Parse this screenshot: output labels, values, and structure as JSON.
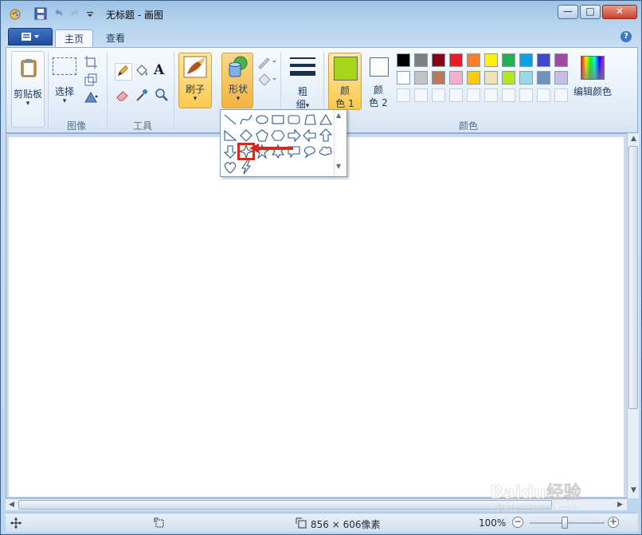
{
  "window": {
    "title": "无标题 - 画图",
    "controls": {
      "minimize": "—",
      "maximize": "□",
      "close": "✕"
    }
  },
  "tabs": {
    "home": "主页",
    "view": "查看",
    "help": "?"
  },
  "ribbon": {
    "clipboard": {
      "label": "剪贴板"
    },
    "image": {
      "select_label": "选择",
      "group_label": "图像"
    },
    "tools": {
      "group_label": "工具",
      "text_tool": "A"
    },
    "brushes": {
      "label": "刷子"
    },
    "shapes": {
      "label": "形状"
    },
    "size": {
      "label_line1": "粗",
      "label_line2": "细"
    },
    "color1": {
      "label_line1": "颜",
      "label_line2": "色 1",
      "color": "#a6d51c"
    },
    "color2": {
      "label_line1": "颜",
      "label_line2": "色 2",
      "color": "#ffffff"
    },
    "colors_group_label": "颜色",
    "edit_colors_label": "编辑颜色",
    "palette_row1": [
      "#000000",
      "#7f7f7f",
      "#880015",
      "#ed1c24",
      "#ff7f27",
      "#fff200",
      "#22b14c",
      "#00a2e8",
      "#3f48cc",
      "#a349a4"
    ],
    "palette_row2": [
      "#ffffff",
      "#c3c3c3",
      "#b97a57",
      "#ffaec9",
      "#ffc90e",
      "#efe4b0",
      "#b5e61d",
      "#99d9ea",
      "#7092be",
      "#c8bfe7"
    ]
  },
  "shapes_panel": {
    "shapes": [
      "line",
      "curve",
      "oval",
      "rectangle",
      "rounded-rectangle",
      "polygon",
      "triangle",
      "right-triangle",
      "diamond",
      "pentagon",
      "hexagon",
      "right-arrow",
      "left-arrow",
      "up-arrow",
      "down-arrow",
      "four-point-star",
      "five-point-star",
      "six-point-star",
      "rounded-callout",
      "oval-callout",
      "cloud-callout",
      "heart",
      "lightning"
    ],
    "selected": "four-point-star"
  },
  "statusbar": {
    "dimensions": "856 × 606像素",
    "zoom": "100%"
  },
  "watermark": {
    "brand": "Baidu经验",
    "url": "jingyan.baidu.com"
  }
}
